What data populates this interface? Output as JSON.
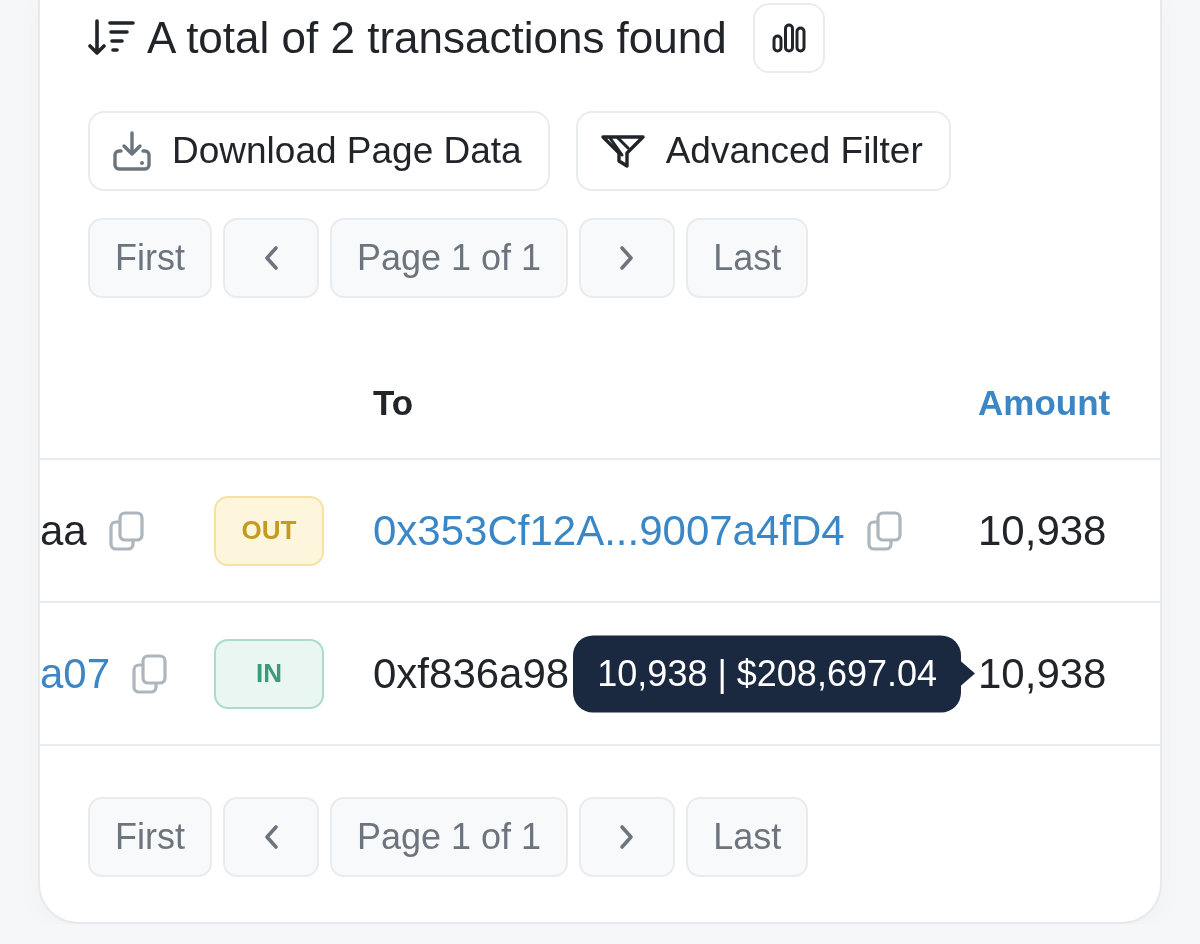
{
  "summary": {
    "text": "A total of 2 transactions found"
  },
  "actions": [
    {
      "label": "Download Page Data",
      "kind": "download"
    },
    {
      "label": "Advanced Filter",
      "kind": "filter"
    }
  ],
  "pagination_top": {
    "first": "First",
    "page": "Page 1 of 1",
    "last": "Last"
  },
  "table": {
    "columns": [
      {
        "label": "To",
        "link": false
      },
      {
        "label": "Amount",
        "link": true
      }
    ],
    "rows": [
      {
        "from": {
          "text": "aa",
          "link": false,
          "copyable": true
        },
        "direction": {
          "label": "OUT",
          "kind": "out"
        },
        "to": {
          "text": "0x353Cf12A...9007a4fD4",
          "link": true,
          "copyable": true
        },
        "amount": "10,938"
      },
      {
        "from": {
          "text": "a07",
          "link": true,
          "copyable": true
        },
        "direction": {
          "label": "IN",
          "kind": "in"
        },
        "to": {
          "text": "0xf836a98",
          "link": false,
          "copyable": false
        },
        "amount": "10,938",
        "tooltip": "10,938 | $208,697.04"
      }
    ]
  },
  "pagination_bottom": {
    "first": "First",
    "page": "Page 1 of 1",
    "last": "Last"
  }
}
